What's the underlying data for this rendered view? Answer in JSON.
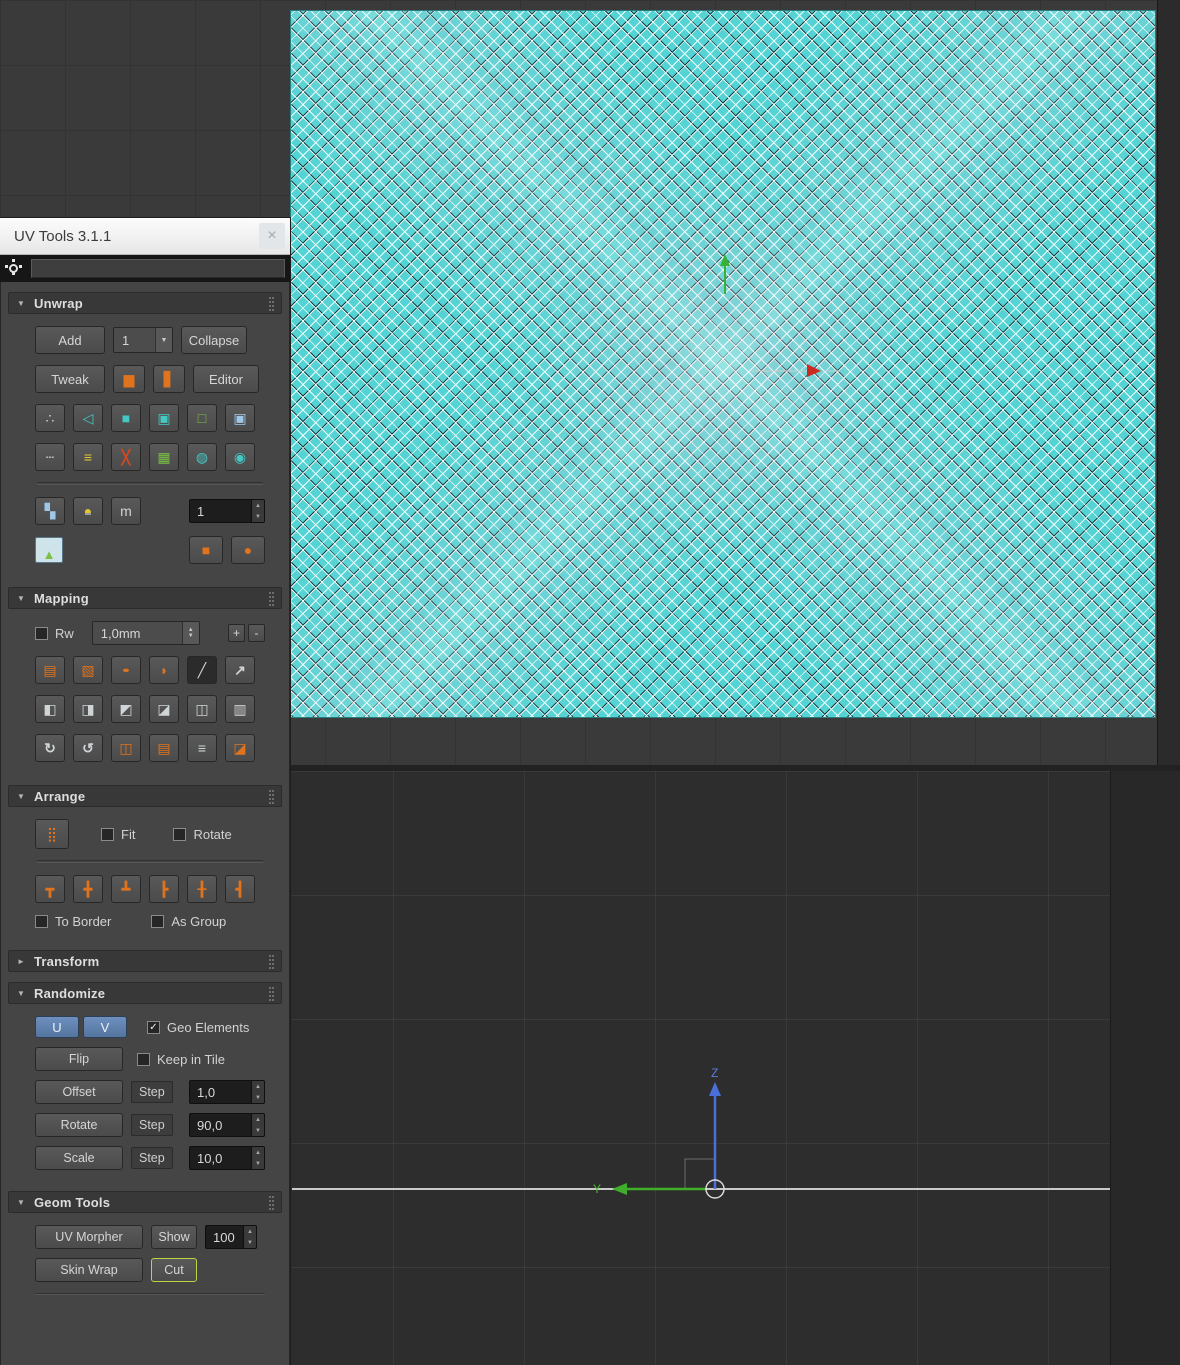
{
  "colors": {
    "uv_teal": "#53d3d3",
    "orange_accent": "#e0731d",
    "green_accent": "#7bc143",
    "blue_button": "#5c7da8",
    "cut_highlight": "#bfd23f",
    "axis_z_blue": "#4a6fd8",
    "axis_y_green": "#3fae2a",
    "viewport_bg": "#3a3a3a",
    "panel_bg": "#454545"
  },
  "window": {
    "title": "UV Tools 3.1.1",
    "close_glyph": "×"
  },
  "glyphs": {
    "check": "✓",
    "dropdown": "▼",
    "spin_up": "▲",
    "spin_down": "▼",
    "rollout_open": "▼",
    "rollout_closed": "►"
  },
  "viewport": {
    "axis_z_label": "Z",
    "axis_y_label": "Y"
  },
  "unwrap": {
    "title": "Unwrap",
    "add_label": "Add",
    "channel_value": "1",
    "collapse_label": "Collapse",
    "tweak_label": "Tweak",
    "editor_label": "Editor",
    "map_channel_value": "1",
    "tool_icons": [
      {
        "name": "uv-strip-icon",
        "glyph": "▆"
      },
      {
        "name": "uv-column-icon",
        "glyph": "▋"
      }
    ],
    "mode_icons": [
      {
        "name": "vertex-mode-icon",
        "glyph": "∴"
      },
      {
        "name": "edge-mode-icon",
        "glyph": "◁"
      },
      {
        "name": "face-mode-icon",
        "glyph": "■"
      },
      {
        "name": "element-mode-icon",
        "glyph": "▣"
      },
      {
        "name": "open-edges-icon",
        "glyph": "□"
      },
      {
        "name": "uv-border-icon",
        "glyph": "▣"
      }
    ],
    "edit_icons": [
      {
        "name": "relax-dashes-icon",
        "glyph": "┄"
      },
      {
        "name": "straighten-lines-icon",
        "glyph": "≡"
      },
      {
        "name": "stitch-break-icon",
        "glyph": "╳"
      },
      {
        "name": "grid-align-icon",
        "glyph": "▦"
      },
      {
        "name": "checker-sphere-icon",
        "glyph": "◍"
      },
      {
        "name": "relax-sphere-icon",
        "glyph": "◉"
      }
    ],
    "display_icons": [
      {
        "name": "checker-map-icon",
        "glyph": "▚"
      },
      {
        "name": "lightbulb-icon",
        "glyph": "●"
      },
      {
        "name": "measure-units-icon",
        "glyph": "m"
      }
    ],
    "material_icons": [
      {
        "name": "bitmap-preview-icon",
        "glyph": "▲"
      },
      {
        "name": "box-preview-icon",
        "glyph": "■"
      },
      {
        "name": "sphere-preview-icon",
        "glyph": "●"
      }
    ]
  },
  "mapping": {
    "title": "Mapping",
    "rw_label": "Rw",
    "size_value": "1,0mm",
    "plus_label": "+",
    "minus_label": "-",
    "projection_icons": [
      {
        "name": "planar-map-icon",
        "glyph": "▤"
      },
      {
        "name": "box-map-icon",
        "glyph": "▧"
      },
      {
        "name": "cylinder-map-icon",
        "glyph": "●"
      },
      {
        "name": "spline-map-icon",
        "glyph": "◗"
      },
      {
        "name": "pick-map-icon",
        "glyph": "╱"
      },
      {
        "name": "fit-map-icon",
        "glyph": "↗"
      }
    ],
    "pack_icons": [
      {
        "name": "pack-left-icon",
        "glyph": "◧"
      },
      {
        "name": "pack-right-icon",
        "glyph": "◨"
      },
      {
        "name": "pack-down-icon",
        "glyph": "◩"
      },
      {
        "name": "pack-up-icon",
        "glyph": "◪"
      },
      {
        "name": "pack-center-icon",
        "glyph": "◫"
      },
      {
        "name": "pack-grid-icon",
        "glyph": "▥"
      }
    ],
    "rotate_icons": [
      {
        "name": "rotate-cw-icon",
        "glyph": "↻"
      },
      {
        "name": "rotate-ccw-icon",
        "glyph": "↺"
      },
      {
        "name": "flip-horizontal-icon",
        "glyph": "◫"
      },
      {
        "name": "flip-vertical-icon",
        "glyph": "▤"
      },
      {
        "name": "align-horizontal-icon",
        "glyph": "≡"
      },
      {
        "name": "align-element-icon",
        "glyph": "◪"
      }
    ]
  },
  "arrange": {
    "title": "Arrange",
    "pack_icon": {
      "name": "pack-arrange-icon",
      "glyph": "⣿"
    },
    "fit_label": "Fit",
    "rotate_label": "Rotate",
    "to_border_label": "To Border",
    "as_group_label": "As Group",
    "align_icons": [
      {
        "name": "align-top-icon",
        "glyph": "┳"
      },
      {
        "name": "align-middle-icon",
        "glyph": "╋"
      },
      {
        "name": "align-bottom-icon",
        "glyph": "┻"
      },
      {
        "name": "align-left-icon",
        "glyph": "┣"
      },
      {
        "name": "align-center-icon",
        "glyph": "╂"
      },
      {
        "name": "align-right-icon",
        "glyph": "┫"
      }
    ]
  },
  "transform": {
    "title": "Transform"
  },
  "randomize": {
    "title": "Randomize",
    "u_label": "U",
    "v_label": "V",
    "geo_elements_label": "Geo Elements",
    "flip_label": "Flip",
    "keep_in_tile_label": "Keep in Tile",
    "offset_label": "Offset",
    "rotate_label": "Rotate",
    "scale_label": "Scale",
    "step_label": "Step",
    "offset_value": "1,0",
    "rotate_value": "90,0",
    "scale_value": "10,0"
  },
  "geom_tools": {
    "title": "Geom Tools",
    "uv_morpher_label": "UV Morpher",
    "show_label": "Show",
    "show_value": "100",
    "skin_wrap_label": "Skin Wrap",
    "cut_label": "Cut"
  }
}
